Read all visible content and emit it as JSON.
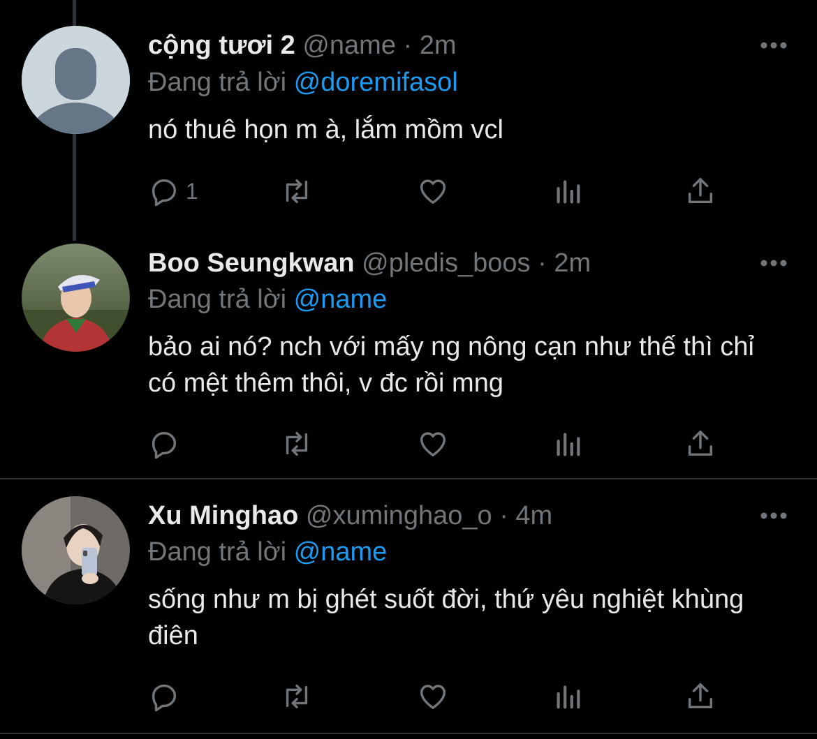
{
  "colors": {
    "background": "#000000",
    "text": "#e7e9ea",
    "muted": "#71767b",
    "link": "#1d9bf0"
  },
  "replying_prefix": "Đang trả lời",
  "tweets": [
    {
      "display_name": "cộng tươi 2",
      "handle": "@name",
      "separator": "·",
      "time": "2m",
      "reply_to": "@doremifasol",
      "text": "nó thuê họn m à, lắm mồm vcl",
      "reply_count": "1",
      "avatar": "default-avatar-icon"
    },
    {
      "display_name": "Boo Seungkwan",
      "handle": "@pledis_boos",
      "separator": "·",
      "time": "2m",
      "reply_to": "@name",
      "text": "bảo ai nó? nch với mấy ng nông cạn như thế thì chỉ có mệt thêm thôi, v đc rồi mng",
      "reply_count": "",
      "avatar": "user-photo"
    },
    {
      "display_name": "Xu Minghao",
      "handle": "@xuminghao_o",
      "separator": "·",
      "time": "4m",
      "reply_to": "@name",
      "text": "sống như m bị ghét suốt đời, thứ yêu nghiệt khùng điên",
      "reply_count": "",
      "avatar": "user-photo"
    }
  ]
}
